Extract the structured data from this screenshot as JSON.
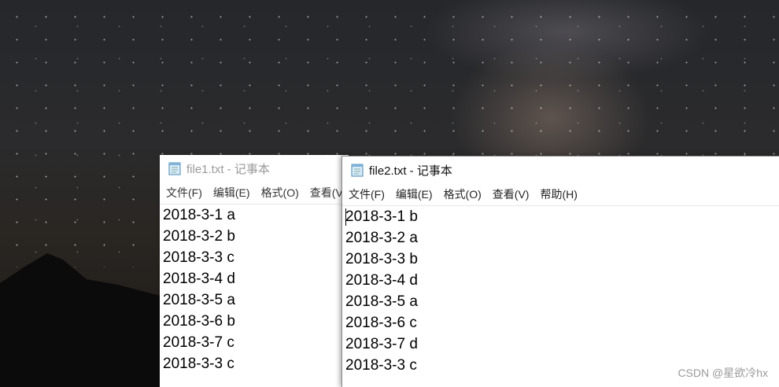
{
  "windows": [
    {
      "title": "file1.txt - 记事本",
      "menu": [
        "文件(F)",
        "编辑(E)",
        "格式(O)",
        "查看(V)"
      ],
      "lines": [
        "2018-3-1 a",
        "2018-3-2 b",
        "2018-3-3 c",
        "2018-3-4 d",
        "2018-3-5 a",
        "2018-3-6 b",
        "2018-3-7 c",
        "2018-3-3 c"
      ],
      "active": false
    },
    {
      "title": "file2.txt - 记事本",
      "menu": [
        "文件(F)",
        "编辑(E)",
        "格式(O)",
        "查看(V)",
        "帮助(H)"
      ],
      "lines": [
        "2018-3-1 b",
        "2018-3-2 a",
        "2018-3-3 b",
        "2018-3-4 d",
        "2018-3-5 a",
        "2018-3-6 c",
        "2018-3-7 d",
        "2018-3-3 c"
      ],
      "active": true
    }
  ],
  "watermark": "CSDN @星欲冷hx",
  "icons": {
    "app": "notepad-icon"
  }
}
